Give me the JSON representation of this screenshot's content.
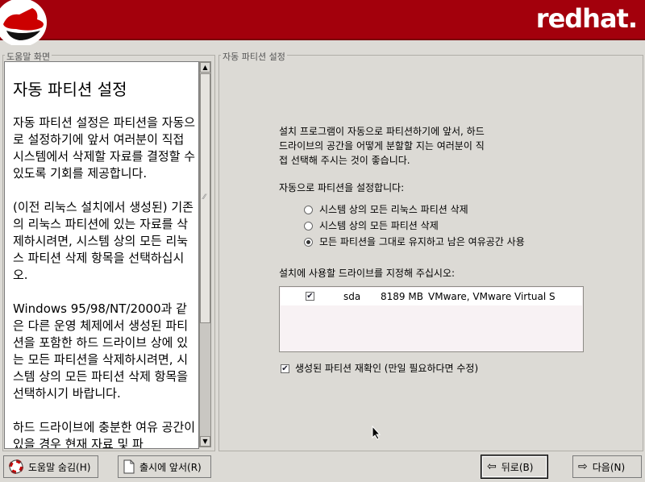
{
  "header": {
    "brand": "redhat."
  },
  "help_panel": {
    "frame_label": "도움말 화면",
    "title": "자동 파티션 설정",
    "paragraphs": [
      "자동 파티션 설정은 파티션을 자동으로 설정하기에 앞서 여러분이 직접 시스템에서 삭제할 자료를 결정할 수 있도록 기회를 제공합니다.",
      "(이전 리눅스 설치에서 생성된) 기존의 리눅스 파티션에 있는 자료를 삭제하시려면, 시스템 상의 모든 리눅스 파티션 삭제 항목을 선택하십시오.",
      "Windows 95/98/NT/2000과 같은 다른 운영 체제에서 생성된 파티션을 포함한 하드 드라이브 상에 있는 모든 파티션을 삭제하시려면, 시스템 상의 모든 파티션 삭제 항목을 선택하시기 바랍니다.",
      "하드 드라이브에 충분한 여유 공간이 있을 경우 현재 자료 및 파"
    ]
  },
  "main": {
    "frame_label": "자동 파티션 설정",
    "intro": [
      "설치 프로그램이 자동으로 파티션하기에 앞서, 하드",
      "드라이브의 공간을 어떻게 분할할 지는 여러분이 직",
      "접 선택해 주시는 것이 좋습니다."
    ],
    "radio_prompt": "자동으로 파티션을 설정합니다:",
    "options": [
      {
        "label": "시스템 상의 모든 리눅스 파티션 삭제",
        "selected": false
      },
      {
        "label": "시스템 상의 모든 파티션 삭제",
        "selected": false
      },
      {
        "label": "모든 파티션을 그대로 유지하고 남은 여유공간 사용",
        "selected": true
      }
    ],
    "drive_prompt": "설치에 사용할 드라이브를 지정해 주십시오:",
    "drives": [
      {
        "checked": true,
        "name": "sda",
        "size": "8189 MB",
        "model": "VMware, VMware Virtual S"
      }
    ],
    "review_label": "생성된 파티션 재확인 (만일 필요하다면 수정)",
    "review_checked": true
  },
  "buttons": {
    "hide_help": "도움말 숨김(H)",
    "release_notes": "출시에 앞서(R)",
    "back": "뒤로(B)",
    "next": "다음(N)"
  },
  "colors": {
    "header_red": "#a3000c",
    "background": "#dcdad5"
  },
  "icons": [
    "redhat-shadowman-logo",
    "lifebuoy-icon",
    "document-icon",
    "arrow-left-icon",
    "arrow-right-icon"
  ]
}
